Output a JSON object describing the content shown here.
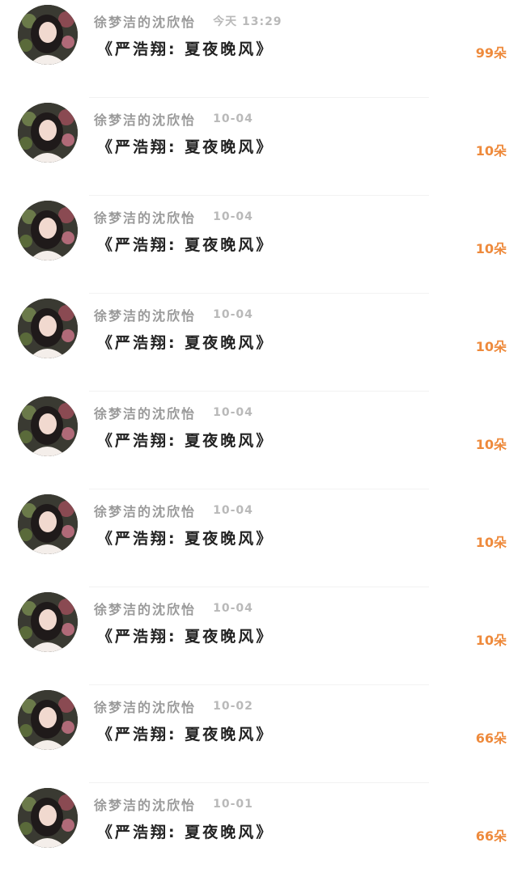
{
  "colors": {
    "name": "#9a9a9a",
    "time": "#b9b9b9",
    "title": "#222222",
    "count": "#ee8a3c",
    "divider": "#f2f2f2"
  },
  "items": [
    {
      "user": "徐梦洁的沈欣怡",
      "time": "今天 13:29",
      "title": "《严浩翔:  夏夜晚风》",
      "count": "99朵"
    },
    {
      "user": "徐梦洁的沈欣怡",
      "time": "10-04",
      "title": "《严浩翔:  夏夜晚风》",
      "count": "10朵"
    },
    {
      "user": "徐梦洁的沈欣怡",
      "time": "10-04",
      "title": "《严浩翔:  夏夜晚风》",
      "count": "10朵"
    },
    {
      "user": "徐梦洁的沈欣怡",
      "time": "10-04",
      "title": "《严浩翔:  夏夜晚风》",
      "count": "10朵"
    },
    {
      "user": "徐梦洁的沈欣怡",
      "time": "10-04",
      "title": "《严浩翔:  夏夜晚风》",
      "count": "10朵"
    },
    {
      "user": "徐梦洁的沈欣怡",
      "time": "10-04",
      "title": "《严浩翔:  夏夜晚风》",
      "count": "10朵"
    },
    {
      "user": "徐梦洁的沈欣怡",
      "time": "10-04",
      "title": "《严浩翔:  夏夜晚风》",
      "count": "10朵"
    },
    {
      "user": "徐梦洁的沈欣怡",
      "time": "10-02",
      "title": "《严浩翔:  夏夜晚风》",
      "count": "66朵"
    },
    {
      "user": "徐梦洁的沈欣怡",
      "time": "10-01",
      "title": "《严浩翔:  夏夜晚风》",
      "count": "66朵"
    }
  ]
}
